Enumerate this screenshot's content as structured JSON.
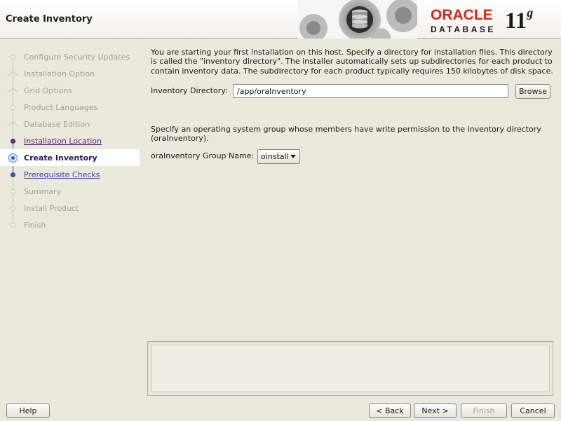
{
  "header": {
    "title": "Create Inventory",
    "brand": {
      "oracle": "ORACLE",
      "db": "DATABASE",
      "version": "11",
      "version_suffix": "g"
    }
  },
  "sidebar": {
    "steps": [
      {
        "label": "Configure Security Updates",
        "state": "pending"
      },
      {
        "label": "Installation Option",
        "state": "pending"
      },
      {
        "label": "Grid Options",
        "state": "pending"
      },
      {
        "label": "Product Languages",
        "state": "pending"
      },
      {
        "label": "Database Edition",
        "state": "pending"
      },
      {
        "label": "Installation Location",
        "state": "visited"
      },
      {
        "label": "Create Inventory",
        "state": "current"
      },
      {
        "label": "Prerequisite Checks",
        "state": "link"
      },
      {
        "label": "Summary",
        "state": "pending"
      },
      {
        "label": "Install Product",
        "state": "pending"
      },
      {
        "label": "Finish",
        "state": "pending"
      }
    ]
  },
  "main": {
    "intro": "You are starting your first installation on this host. Specify a directory for installation files. This directory is called the \"inventory directory\". The installer automatically sets up subdirectories for each product to contain inventory data. The subdirectory for each product typically requires 150 kilobytes of disk space.",
    "inventory_label": "Inventory Directory:",
    "inventory_value": "/app/oraInventory",
    "browse_label": "Browse",
    "group_text": "Specify an operating system group whose members have write permission to the inventory directory (oraInventory).",
    "group_label": "oraInventory Group Name:",
    "group_value": "oinstall"
  },
  "footer": {
    "help": "Help",
    "back": "< Back",
    "next": "Next >",
    "finish": "Finish",
    "cancel": "Cancel"
  },
  "colors": {
    "background": "#ebe8dc",
    "oracle_red": "#e2231a",
    "link": "#3b3bb0",
    "active_step": "#3c5fb4"
  }
}
